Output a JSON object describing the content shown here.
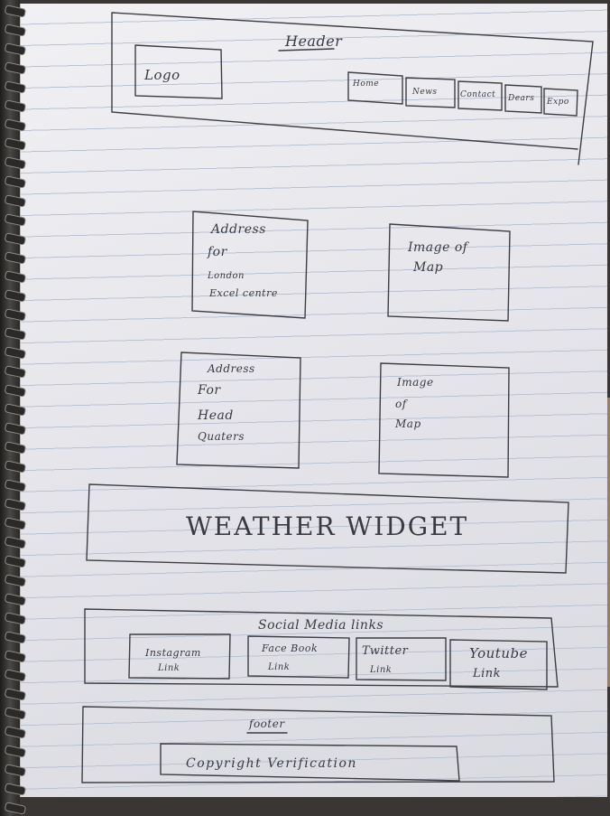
{
  "header": {
    "title": "Header",
    "logo": "Logo",
    "nav": [
      "Home",
      "News",
      "Contact",
      "Dears",
      "Expo"
    ]
  },
  "section1": {
    "address_lines": [
      "Address",
      "for",
      "London",
      "Excel centre"
    ],
    "map_lines": [
      "Image of",
      "Map"
    ]
  },
  "section2": {
    "address_lines": [
      "Address",
      "For",
      "Head",
      "Quaters"
    ],
    "map_lines": [
      "Image",
      "of",
      "Map"
    ]
  },
  "weather": {
    "label": "WEATHER WIDGET"
  },
  "social": {
    "title": "Social Media links",
    "links": [
      {
        "top": "Instagram",
        "bottom": "Link"
      },
      {
        "top": "Face Book",
        "bottom": "Link"
      },
      {
        "top": "Twitter",
        "bottom": "Link"
      },
      {
        "top": "Youtube",
        "bottom": "Link"
      }
    ]
  },
  "footer": {
    "title": "footer",
    "copyright": "Copyright Verification"
  }
}
